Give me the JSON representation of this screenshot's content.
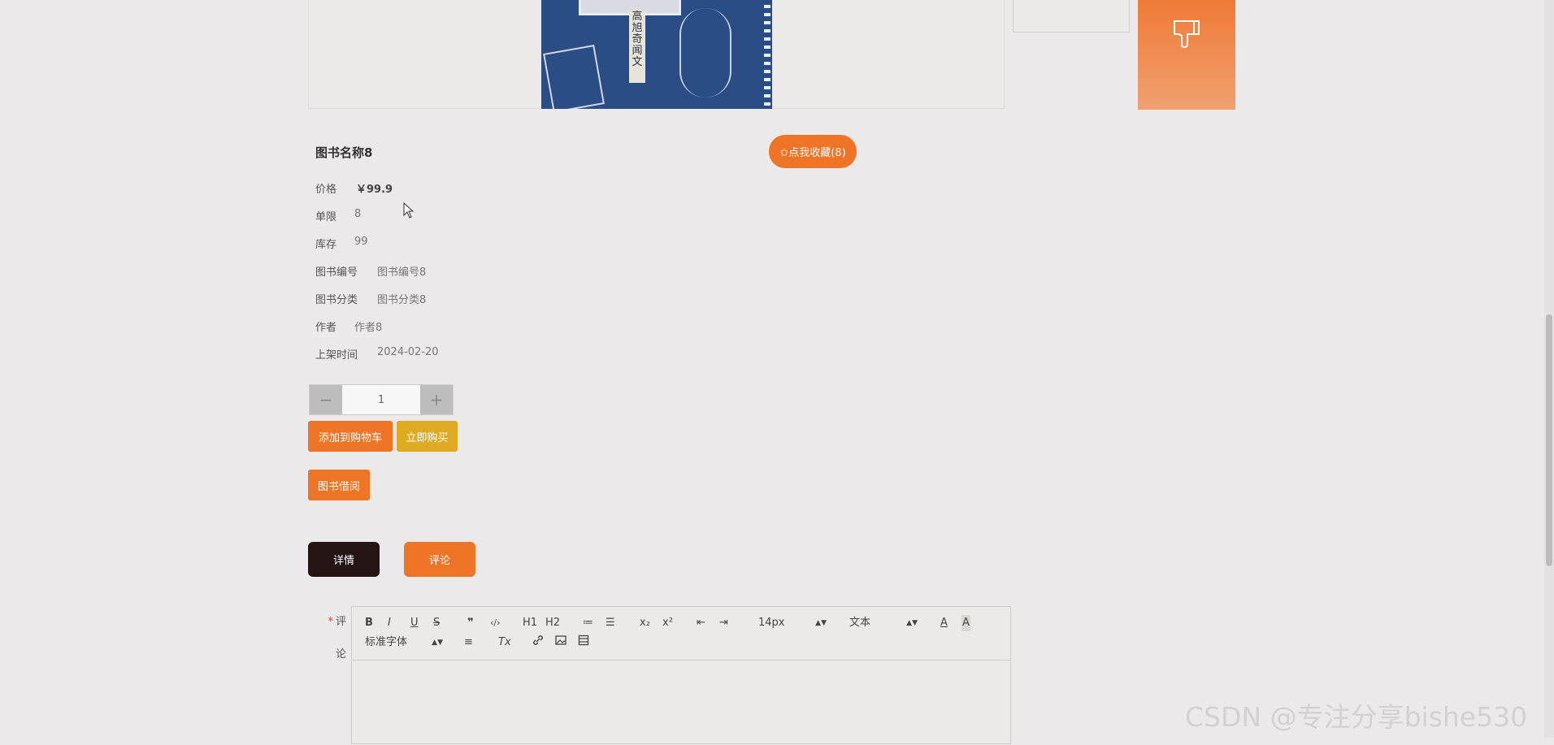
{
  "book": {
    "name": "图书名称8",
    "cover_text": "高旭奇闻文",
    "favorite_label": "✩点我收藏(8)"
  },
  "details": [
    {
      "label": "价格",
      "value": "￥99.9"
    },
    {
      "label": "单限",
      "value": "8"
    },
    {
      "label": "库存",
      "value": "99"
    },
    {
      "label": "图书编号",
      "value": "图书编号8"
    },
    {
      "label": "图书分类",
      "value": "图书分类8"
    },
    {
      "label": "作者",
      "value": "作者8"
    },
    {
      "label": "上架时间",
      "value": "2024-02-20"
    }
  ],
  "quantity": {
    "value": "1",
    "minus": "−",
    "plus": "+"
  },
  "actions": {
    "add_to_cart": "添加到购物车",
    "buy_now": "立即购买",
    "borrow": "图书借阅"
  },
  "tabs": {
    "detail": "详情",
    "comment": "评论"
  },
  "comment_form": {
    "required_mark": "*",
    "label_line1": "评",
    "label_line2": "论",
    "toolbar": {
      "bold": "B",
      "italic": "I",
      "underline": "U",
      "strike": "S",
      "quote": "❞",
      "code": "‹/›",
      "h1": "H1",
      "h2": "H2",
      "ordered_list": "≔",
      "bullet_list": "☰",
      "subscript": "x₂",
      "superscript": "x²",
      "outdent": "⇤",
      "indent": "⇥",
      "font_size": "14px",
      "format": "文本",
      "font_family": "标准字体",
      "align": "≡",
      "clear": "Tx",
      "link": "🔗",
      "image": "▣",
      "video": "▤"
    }
  },
  "watermark": "CSDN @专注分享bishe530",
  "colors": {
    "accent": "#ef7425",
    "buy": "#ddaa22",
    "dark_tab": "#241414",
    "background": "#ebe9e9"
  }
}
